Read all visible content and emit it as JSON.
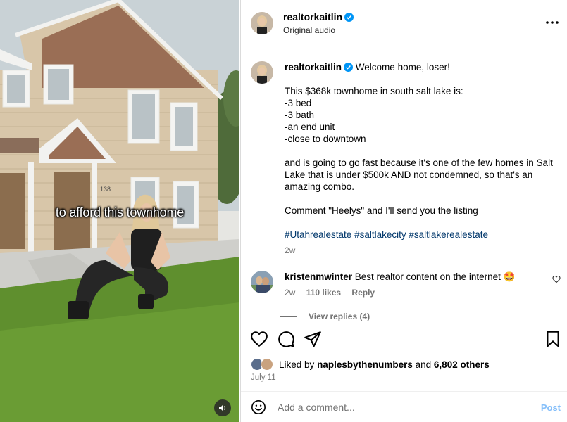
{
  "video": {
    "caption": "to afford this townhome",
    "house_number": "138",
    "mute_icon": "speaker-icon"
  },
  "header": {
    "username": "realtorkaitlin",
    "audio": "Original audio",
    "more_icon": "more-dots-icon"
  },
  "post": {
    "username": "realtorkaitlin",
    "first_line": "Welcome home, loser!",
    "lines": [
      "This $368k townhome in south salt lake is:",
      "-3 bed",
      "-3 bath",
      "-an end unit",
      "-close to downtown"
    ],
    "paragraph": "and is going to go fast because it's one of the few homes in Salt Lake that is under $500k AND not condemned, so that's an amazing combo.",
    "cta": "Comment \"Heelys\" and I'll send you the listing",
    "hashtags": [
      "#Utahrealestate",
      "#saltlakecity",
      "#saltlakerealestate"
    ],
    "age": "2w"
  },
  "comment": {
    "username": "kristenmwinter",
    "text": "Best realtor content on the internet",
    "emoji": "🤩",
    "age": "2w",
    "likes": "110 likes",
    "reply": "Reply",
    "view_replies": "View replies (4)"
  },
  "actions": {
    "liked_prefix": "Liked by",
    "liked_user": "naplesbythenumbers",
    "liked_and": "and",
    "liked_count": "6,802 others",
    "date": "July 11"
  },
  "composer": {
    "placeholder": "Add a comment...",
    "post_label": "Post"
  },
  "colors": {
    "verified": "#0095f6",
    "hashtag": "#00376b",
    "muted": "#737373",
    "post_disabled": "#85bffa"
  }
}
